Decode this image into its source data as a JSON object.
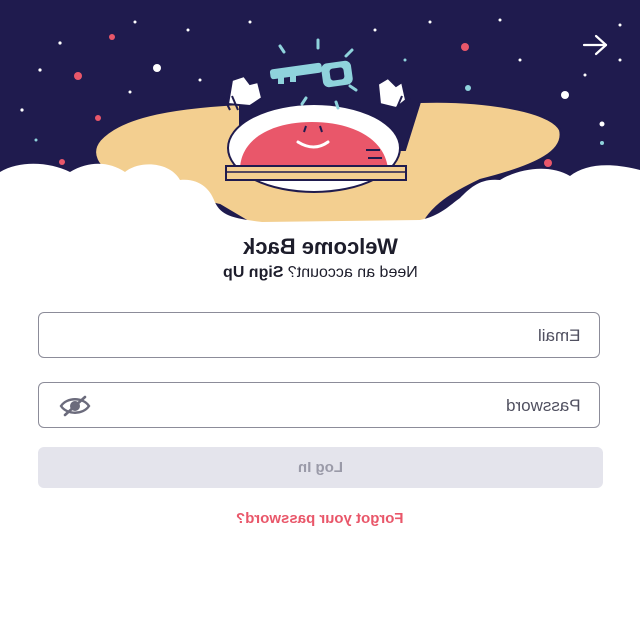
{
  "header": {
    "nav_icon": "arrow-right-icon",
    "illustration": "astronaut-holding-key"
  },
  "login": {
    "title": "Welcome Back",
    "subtitle_prefix": "Need an account? ",
    "signup_link": "Sign Up",
    "email_placeholder": "Email",
    "password_placeholder": "Password",
    "password_toggle_icon": "eye-slash-icon",
    "submit_label": "Log In",
    "submit_enabled": false,
    "forgot_link": "Forgot your password?"
  },
  "colors": {
    "sky": "#1f1b4e",
    "body_skin": "#f3cf90",
    "face": "#e9576a",
    "key": "#8fd3dc",
    "accent_link": "#e9576a",
    "button_disabled_bg": "#e4e4ec",
    "button_disabled_text": "#9a9aa8"
  }
}
